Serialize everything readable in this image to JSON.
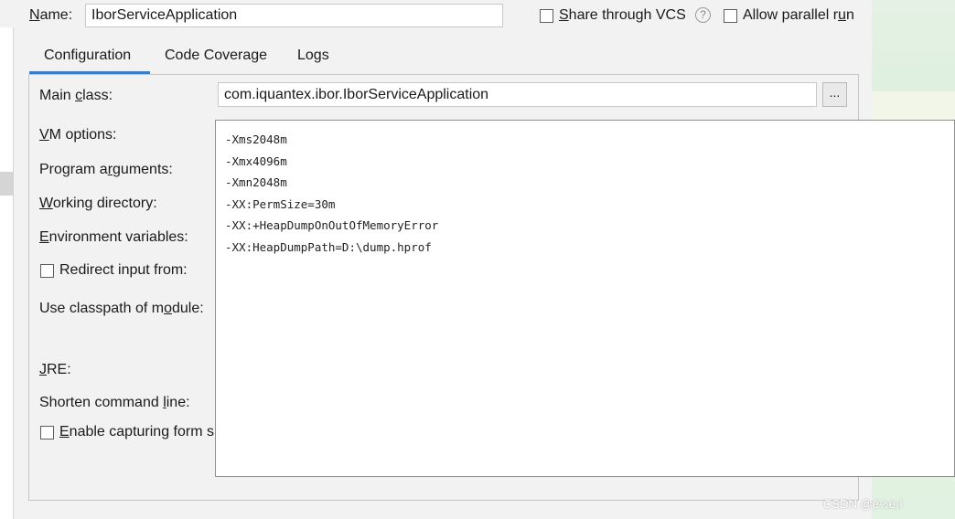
{
  "name": {
    "label_pre": "",
    "label_key": "N",
    "label_post": "ame:",
    "value": "IborServiceApplication"
  },
  "share_vcs": {
    "label_pre": "",
    "label_key": "S",
    "label_post": "hare through VCS",
    "checked": false
  },
  "help_icon": "?",
  "allow_parallel": {
    "label_pre": "Allow parallel r",
    "label_key": "u",
    "label_post": "n",
    "checked": false
  },
  "tabs": [
    {
      "label": "Configuration",
      "active": true
    },
    {
      "label": "Code Coverage",
      "active": false
    },
    {
      "label": "Logs",
      "active": false
    }
  ],
  "form": {
    "main_class": {
      "label_pre": "Main ",
      "label_key": "c",
      "label_post": "lass:",
      "value": "com.iquantex.ibor.IborServiceApplication"
    },
    "browse_label": "...",
    "vm_options": {
      "label_pre": "",
      "label_key": "V",
      "label_post": "M options:"
    },
    "program_arguments": {
      "label_pre": "Program a",
      "label_key": "r",
      "label_post": "guments:"
    },
    "working_directory": {
      "label_pre": "",
      "label_key": "W",
      "label_post": "orking directory:"
    },
    "environment_variables": {
      "label_pre": "",
      "label_key": "E",
      "label_post": "nvironment variables:"
    },
    "redirect_input": {
      "label": "Redirect input from:",
      "checked": false
    },
    "use_classpath": {
      "label_pre": "Use classpath of m",
      "label_key": "o",
      "label_post": "dule:"
    },
    "jre": {
      "label_pre": "",
      "label_key": "J",
      "label_post": "RE:"
    },
    "shorten_command": {
      "label_pre": "Shorten command ",
      "label_key": "l",
      "label_post": "ine:"
    },
    "enable_capturing": {
      "label_pre": "",
      "label_key": "E",
      "label_post": "nable capturing form s",
      "checked": false
    }
  },
  "vm_editor": {
    "lines": [
      "-Xms2048m",
      "-Xmx4096m",
      "-Xmn2048m",
      "-XX:PermSize=30m",
      "-XX:+HeapDumpOnOutOfMemoryError",
      "-XX:HeapDumpPath=D:\\dump.hprof"
    ]
  },
  "watermark": "CSDN @é½é¡ì"
}
